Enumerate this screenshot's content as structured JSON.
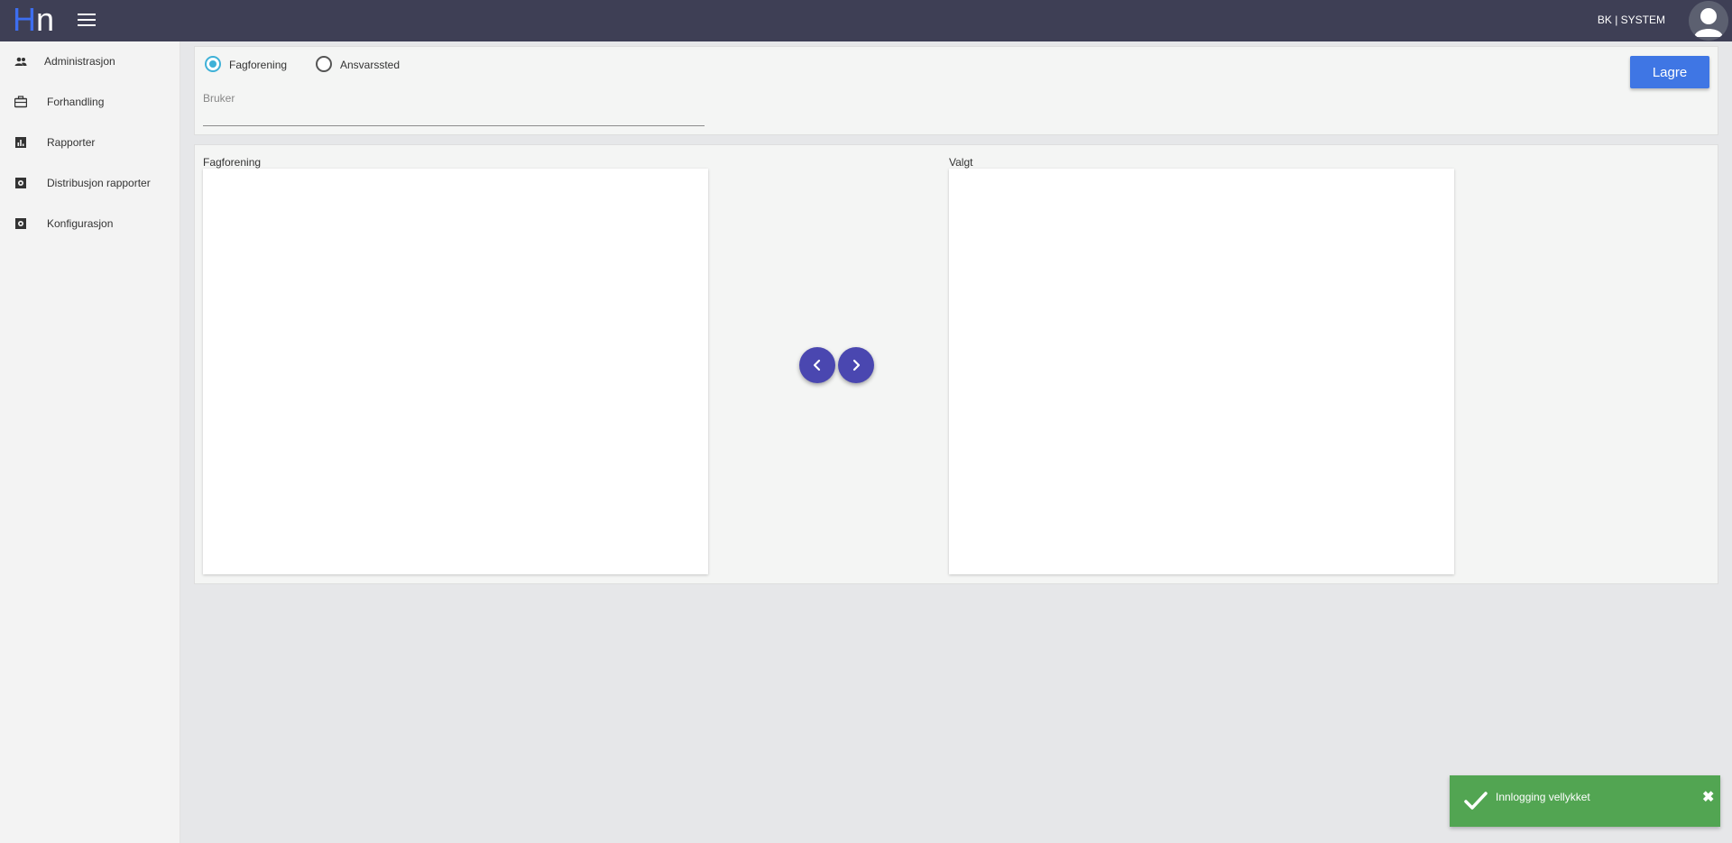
{
  "header": {
    "logo_h": "H",
    "logo_n": "n",
    "user_label": "BK | SYSTEM"
  },
  "sidebar": {
    "items": [
      {
        "label": "Administrasjon",
        "icon": "people-icon"
      },
      {
        "label": "Forhandling",
        "icon": "briefcase-icon"
      },
      {
        "label": "Rapporter",
        "icon": "bar-chart-icon"
      },
      {
        "label": "Distribusjon rapporter",
        "icon": "settings-box-icon"
      },
      {
        "label": "Konfigurasjon",
        "icon": "settings-box-icon"
      }
    ]
  },
  "form": {
    "radio_options": [
      {
        "label": "Fagforening",
        "selected": true
      },
      {
        "label": "Ansvarssted",
        "selected": false
      }
    ],
    "user_field_label": "Bruker",
    "user_field_value": "",
    "save_label": "Lagre"
  },
  "lists": {
    "left_title": "Fagforening",
    "right_title": "Valgt",
    "left_items": [],
    "right_items": []
  },
  "toast": {
    "message": "Innlogging vellykket",
    "close_symbol": "✖"
  },
  "colors": {
    "topbar": "#3e3f55",
    "accent_blue": "#3f76e4",
    "radio_selected": "#3fb1d7",
    "arrow_buttons": "#4a47b0",
    "toast_success": "#52a552"
  }
}
